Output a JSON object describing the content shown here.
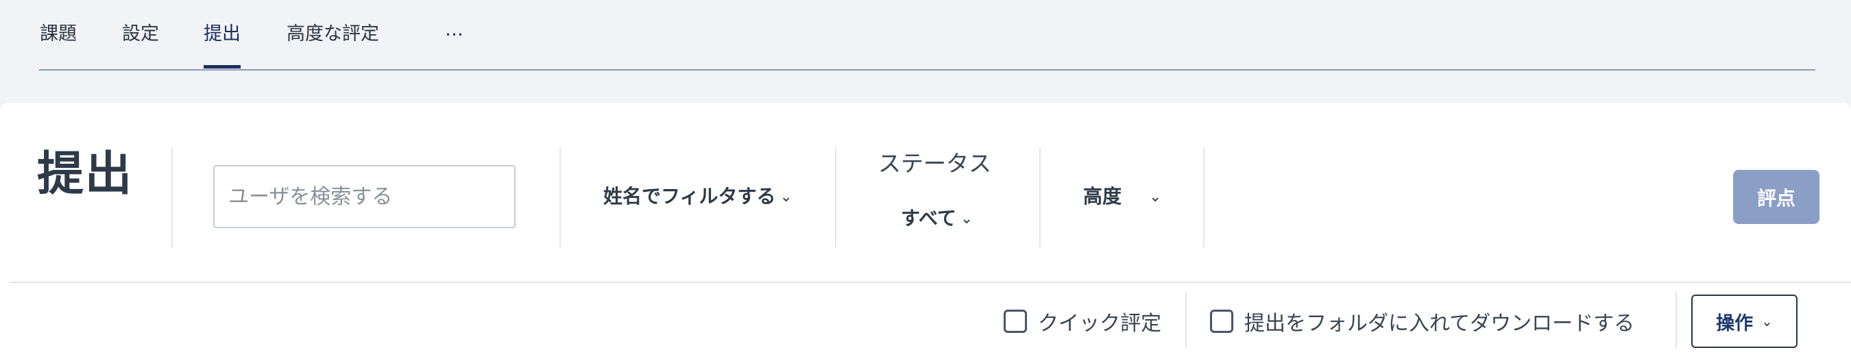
{
  "tabs": [
    {
      "label": "課題",
      "active": false
    },
    {
      "label": "設定",
      "active": false
    },
    {
      "label": "提出",
      "active": true
    },
    {
      "label": "高度な評定",
      "active": false
    },
    {
      "label": "…",
      "active": false
    }
  ],
  "page": {
    "title": "提出"
  },
  "search": {
    "placeholder": "ユーザを検索する",
    "value": ""
  },
  "filters": {
    "name_filter": "姓名でフィルタする",
    "status_label": "ステータス",
    "status_value": "すべて",
    "advanced": "高度"
  },
  "actions": {
    "grade_label": "評点",
    "quick_grading": "クイック評定",
    "download_folders": "提出をフォルダに入れてダウンロードする",
    "operations": "操作"
  },
  "colors": {
    "accent": "#1d2c5a",
    "grade_button": "#8a9ec6",
    "background": "#f1f3f7"
  }
}
